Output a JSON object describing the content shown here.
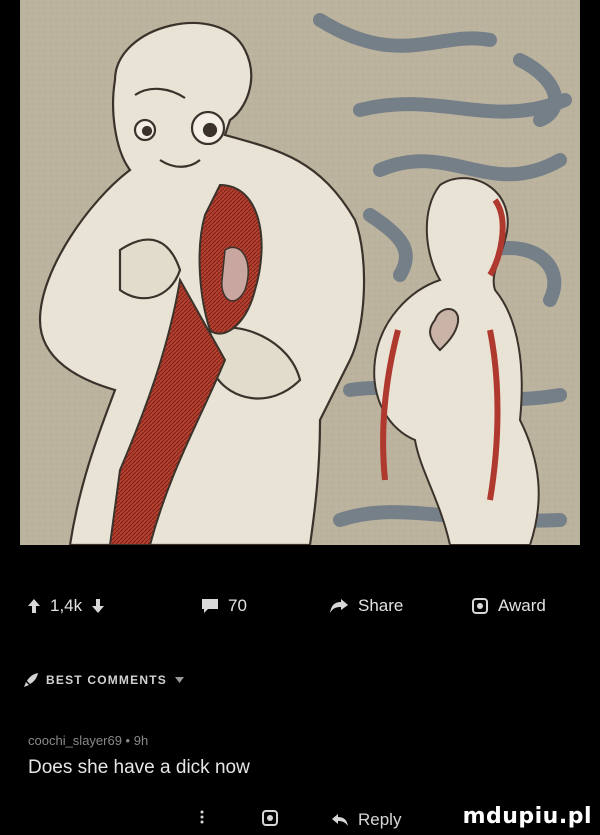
{
  "post": {
    "upvotes": "1,4k",
    "comments_count": "70",
    "share_label": "Share",
    "award_label": "Award"
  },
  "comments_section": {
    "sort_label": "BEST COMMENTS"
  },
  "comment": {
    "meta": "coochi_slayer69 • 9h",
    "text": "Does she have a dick now",
    "reply_label": "Reply"
  },
  "watermark": {
    "text": "mdupiu.pl"
  },
  "colors": {
    "background": "#000000",
    "art_paper": "#bcb39f",
    "ribbon": "#7d8893",
    "red_lining": "#b0392f"
  }
}
